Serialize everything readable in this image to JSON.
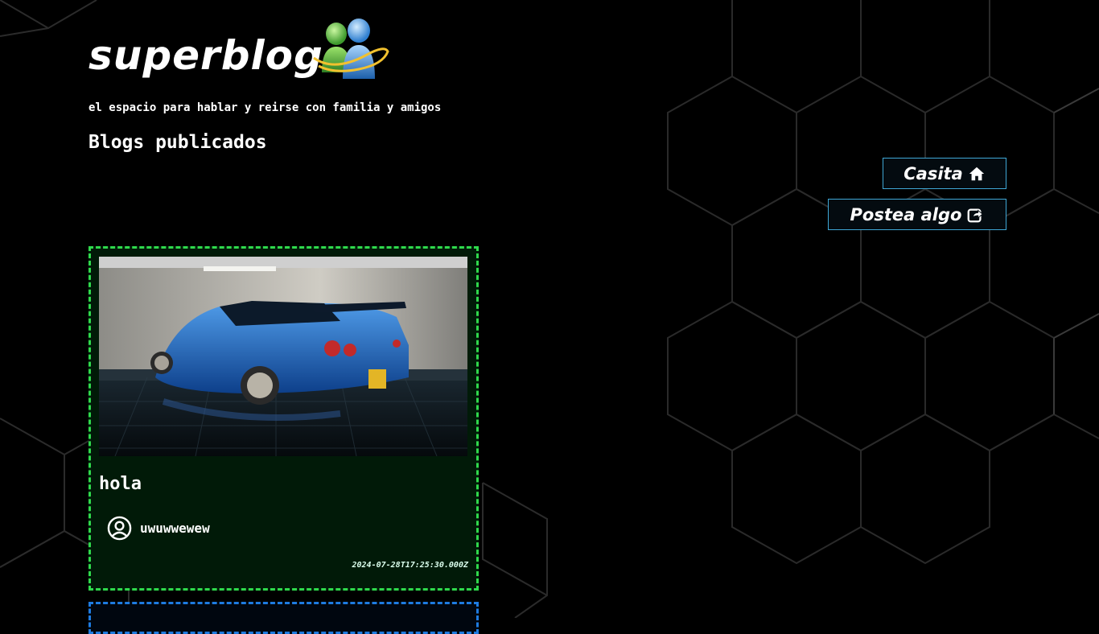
{
  "header": {
    "logo_text": "superblog",
    "logo_icon": "messenger-buddies-icon",
    "tagline": "el espacio para hablar y reirse con familia y amigos",
    "page_heading": "Blogs publicados"
  },
  "nav": {
    "home_label": "Casita",
    "home_icon": "home-icon",
    "post_label": "Postea algo",
    "post_icon": "share-icon",
    "accent": "#3fa7d6"
  },
  "posts": [
    {
      "title": "hola",
      "author": "uwuwwewew",
      "timestamp": "2024-07-28T17:25:30.000Z",
      "image": "blue-sports-car-photo",
      "border_color": "#2fd94c"
    },
    {
      "border_color": "#1e7be0"
    }
  ]
}
